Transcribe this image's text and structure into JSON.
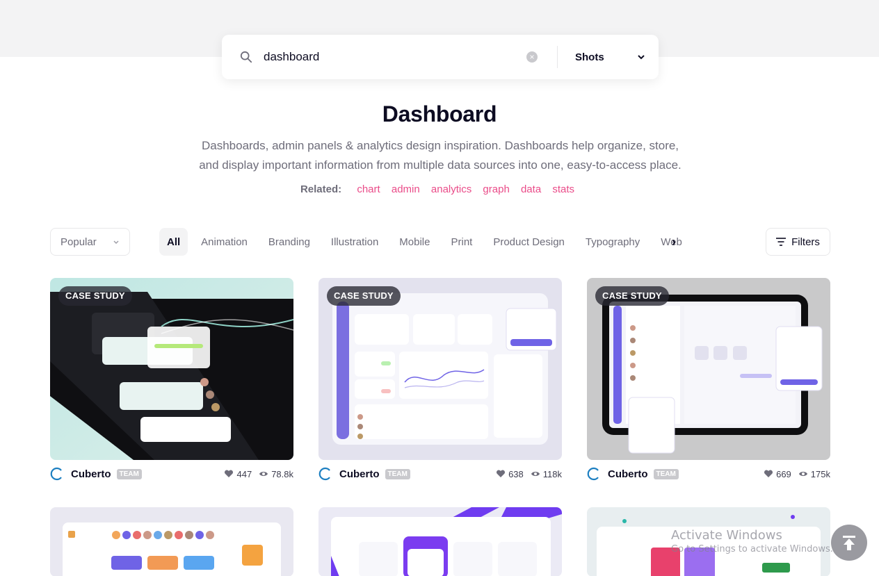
{
  "search": {
    "query": "dashboard",
    "scope": "Shots"
  },
  "header": {
    "title": "Dashboard",
    "description": "Dashboards, admin panels & analytics design inspiration. Dashboards help organize, store, and display important information from multiple data sources into one, easy-to-access place.",
    "related_label": "Related:",
    "related": [
      "chart",
      "admin",
      "analytics",
      "graph",
      "data",
      "stats"
    ]
  },
  "toolbar": {
    "sort": "Popular",
    "categories": [
      "All",
      "Animation",
      "Branding",
      "Illustration",
      "Mobile",
      "Print",
      "Product Design",
      "Typography",
      "Web"
    ],
    "active_category": "All",
    "filters_label": "Filters"
  },
  "shots": [
    {
      "badge": "CASE STUDY",
      "author": "Cuberto",
      "team": "TEAM",
      "likes": "447",
      "views": "78.8k"
    },
    {
      "badge": "CASE STUDY",
      "author": "Cuberto",
      "team": "TEAM",
      "likes": "638",
      "views": "118k"
    },
    {
      "badge": "CASE STUDY",
      "author": "Cuberto",
      "team": "TEAM",
      "likes": "669",
      "views": "175k"
    }
  ],
  "windows_watermark": {
    "line1": "Activate Windows",
    "line2": "Go to Settings to activate Windows."
  },
  "colors": {
    "accent": "#ea4c89",
    "text": "#0d0c22",
    "muted": "#6e6d7a"
  }
}
